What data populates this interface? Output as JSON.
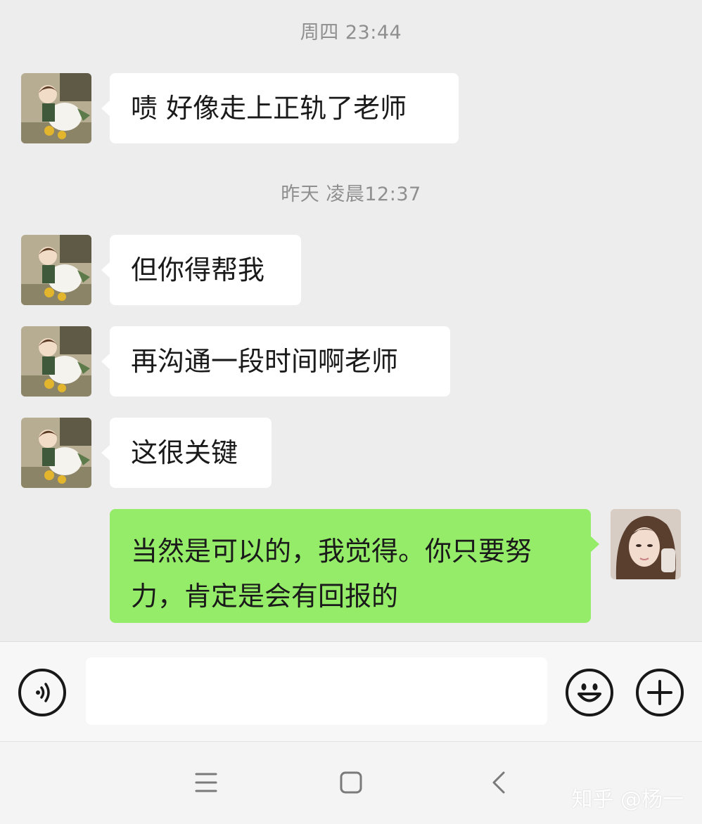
{
  "chat": {
    "messages": [
      {
        "type": "timestamp",
        "text": "周四 23:44"
      },
      {
        "type": "received",
        "text": "啧 好像走上正轨了老师"
      },
      {
        "type": "timestamp",
        "text": "昨天 凌晨12:37"
      },
      {
        "type": "received",
        "text": "但你得帮我"
      },
      {
        "type": "received",
        "text": "再沟通一段时间啊老师"
      },
      {
        "type": "received",
        "text": "这很关键"
      },
      {
        "type": "sent",
        "line1": "当然是可以的，我觉得。你只要努",
        "line2": "力，肯定是会有回报的"
      }
    ]
  },
  "input_bar": {
    "voice_icon": "voice-icon",
    "emoji_icon": "smiley-icon",
    "add_icon": "plus-icon",
    "input_value": ""
  },
  "nav_bar": {
    "menu_icon": "menu-icon",
    "home_icon": "home-square-icon",
    "back_icon": "back-chevron-icon"
  },
  "watermark": "知乎 @杨一",
  "colors": {
    "background": "#ededed",
    "received_bubble": "#ffffff",
    "sent_bubble": "#95ec69",
    "timestamp_text": "#8f8f8f"
  }
}
